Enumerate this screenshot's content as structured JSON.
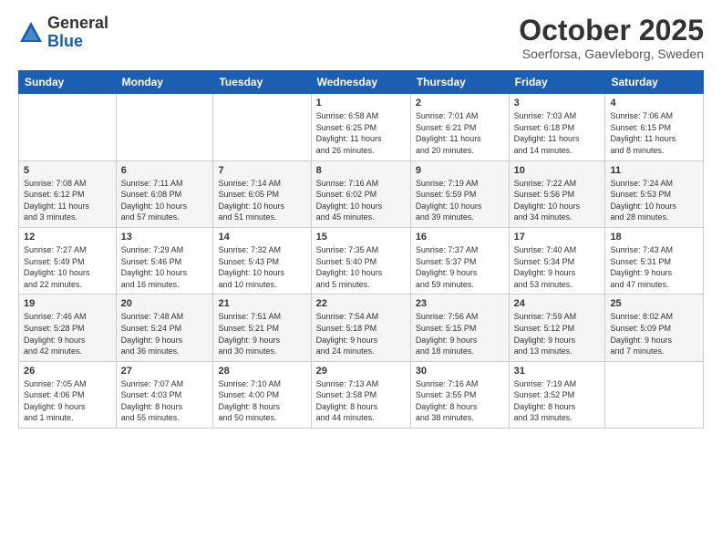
{
  "header": {
    "logo_general": "General",
    "logo_blue": "Blue",
    "month_title": "October 2025",
    "subtitle": "Soerforsa, Gaevleborg, Sweden"
  },
  "weekdays": [
    "Sunday",
    "Monday",
    "Tuesday",
    "Wednesday",
    "Thursday",
    "Friday",
    "Saturday"
  ],
  "rows": [
    [
      {
        "day": "",
        "info": ""
      },
      {
        "day": "",
        "info": ""
      },
      {
        "day": "",
        "info": ""
      },
      {
        "day": "1",
        "info": "Sunrise: 6:58 AM\nSunset: 6:25 PM\nDaylight: 11 hours\nand 26 minutes."
      },
      {
        "day": "2",
        "info": "Sunrise: 7:01 AM\nSunset: 6:21 PM\nDaylight: 11 hours\nand 20 minutes."
      },
      {
        "day": "3",
        "info": "Sunrise: 7:03 AM\nSunset: 6:18 PM\nDaylight: 11 hours\nand 14 minutes."
      },
      {
        "day": "4",
        "info": "Sunrise: 7:06 AM\nSunset: 6:15 PM\nDaylight: 11 hours\nand 8 minutes."
      }
    ],
    [
      {
        "day": "5",
        "info": "Sunrise: 7:08 AM\nSunset: 6:12 PM\nDaylight: 11 hours\nand 3 minutes."
      },
      {
        "day": "6",
        "info": "Sunrise: 7:11 AM\nSunset: 6:08 PM\nDaylight: 10 hours\nand 57 minutes."
      },
      {
        "day": "7",
        "info": "Sunrise: 7:14 AM\nSunset: 6:05 PM\nDaylight: 10 hours\nand 51 minutes."
      },
      {
        "day": "8",
        "info": "Sunrise: 7:16 AM\nSunset: 6:02 PM\nDaylight: 10 hours\nand 45 minutes."
      },
      {
        "day": "9",
        "info": "Sunrise: 7:19 AM\nSunset: 5:59 PM\nDaylight: 10 hours\nand 39 minutes."
      },
      {
        "day": "10",
        "info": "Sunrise: 7:22 AM\nSunset: 5:56 PM\nDaylight: 10 hours\nand 34 minutes."
      },
      {
        "day": "11",
        "info": "Sunrise: 7:24 AM\nSunset: 5:53 PM\nDaylight: 10 hours\nand 28 minutes."
      }
    ],
    [
      {
        "day": "12",
        "info": "Sunrise: 7:27 AM\nSunset: 5:49 PM\nDaylight: 10 hours\nand 22 minutes."
      },
      {
        "day": "13",
        "info": "Sunrise: 7:29 AM\nSunset: 5:46 PM\nDaylight: 10 hours\nand 16 minutes."
      },
      {
        "day": "14",
        "info": "Sunrise: 7:32 AM\nSunset: 5:43 PM\nDaylight: 10 hours\nand 10 minutes."
      },
      {
        "day": "15",
        "info": "Sunrise: 7:35 AM\nSunset: 5:40 PM\nDaylight: 10 hours\nand 5 minutes."
      },
      {
        "day": "16",
        "info": "Sunrise: 7:37 AM\nSunset: 5:37 PM\nDaylight: 9 hours\nand 59 minutes."
      },
      {
        "day": "17",
        "info": "Sunrise: 7:40 AM\nSunset: 5:34 PM\nDaylight: 9 hours\nand 53 minutes."
      },
      {
        "day": "18",
        "info": "Sunrise: 7:43 AM\nSunset: 5:31 PM\nDaylight: 9 hours\nand 47 minutes."
      }
    ],
    [
      {
        "day": "19",
        "info": "Sunrise: 7:46 AM\nSunset: 5:28 PM\nDaylight: 9 hours\nand 42 minutes."
      },
      {
        "day": "20",
        "info": "Sunrise: 7:48 AM\nSunset: 5:24 PM\nDaylight: 9 hours\nand 36 minutes."
      },
      {
        "day": "21",
        "info": "Sunrise: 7:51 AM\nSunset: 5:21 PM\nDaylight: 9 hours\nand 30 minutes."
      },
      {
        "day": "22",
        "info": "Sunrise: 7:54 AM\nSunset: 5:18 PM\nDaylight: 9 hours\nand 24 minutes."
      },
      {
        "day": "23",
        "info": "Sunrise: 7:56 AM\nSunset: 5:15 PM\nDaylight: 9 hours\nand 18 minutes."
      },
      {
        "day": "24",
        "info": "Sunrise: 7:59 AM\nSunset: 5:12 PM\nDaylight: 9 hours\nand 13 minutes."
      },
      {
        "day": "25",
        "info": "Sunrise: 8:02 AM\nSunset: 5:09 PM\nDaylight: 9 hours\nand 7 minutes."
      }
    ],
    [
      {
        "day": "26",
        "info": "Sunrise: 7:05 AM\nSunset: 4:06 PM\nDaylight: 9 hours\nand 1 minute."
      },
      {
        "day": "27",
        "info": "Sunrise: 7:07 AM\nSunset: 4:03 PM\nDaylight: 8 hours\nand 55 minutes."
      },
      {
        "day": "28",
        "info": "Sunrise: 7:10 AM\nSunset: 4:00 PM\nDaylight: 8 hours\nand 50 minutes."
      },
      {
        "day": "29",
        "info": "Sunrise: 7:13 AM\nSunset: 3:58 PM\nDaylight: 8 hours\nand 44 minutes."
      },
      {
        "day": "30",
        "info": "Sunrise: 7:16 AM\nSunset: 3:55 PM\nDaylight: 8 hours\nand 38 minutes."
      },
      {
        "day": "31",
        "info": "Sunrise: 7:19 AM\nSunset: 3:52 PM\nDaylight: 8 hours\nand 33 minutes."
      },
      {
        "day": "",
        "info": ""
      }
    ]
  ]
}
